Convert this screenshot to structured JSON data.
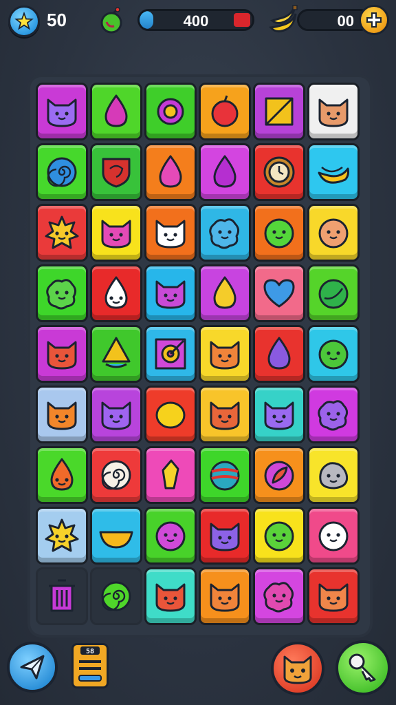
{
  "hud": {
    "stars": "50",
    "progress_value": "400",
    "progress_level": 0.12,
    "coins": "00",
    "icons": {
      "star": "star-icon",
      "apple": "apple-icon",
      "banana": "banana-icon",
      "plus": "plus-icon"
    }
  },
  "board": {
    "rows": [
      [
        {
          "bg": "#c93ad6",
          "icon": "cat-face-icon",
          "fg": "#9b6cf2"
        },
        {
          "bg": "#4fd62a",
          "icon": "drop-icon",
          "fg": "#d63ab8"
        },
        {
          "bg": "#3fce2a",
          "icon": "ring-icon",
          "fg": "#c53ad6"
        },
        {
          "bg": "#f6a21c",
          "icon": "apple-fruit-icon",
          "fg": "#e8333a"
        },
        {
          "bg": "#b742d8",
          "icon": "square-icon",
          "fg": "#f2c21c"
        },
        {
          "bg": "#f0f0f0",
          "icon": "cat-face-icon",
          "fg": "#e79a6a"
        }
      ],
      [
        {
          "bg": "#46d82c",
          "icon": "spiral-icon",
          "fg": "#2f8fe0"
        },
        {
          "bg": "#38c23a",
          "icon": "shield-icon",
          "fg": "#d6322e"
        },
        {
          "bg": "#f47e1c",
          "icon": "drop-icon",
          "fg": "#e54ab8"
        },
        {
          "bg": "#d345e0",
          "icon": "drop-icon",
          "fg": "#b52fd0"
        },
        {
          "bg": "#e8332e",
          "icon": "clock-icon",
          "fg": "#f3e6c2"
        },
        {
          "bg": "#2ec7ef",
          "icon": "banana-fruit-icon",
          "fg": "#f6c21c"
        }
      ],
      [
        {
          "bg": "#ea3a3a",
          "icon": "sun-icon",
          "fg": "#f6c92a"
        },
        {
          "bg": "#f8e21c",
          "icon": "cat-face-icon",
          "fg": "#e44ab6"
        },
        {
          "bg": "#f2701c",
          "icon": "cat-face-icon",
          "fg": "#ffffff"
        },
        {
          "bg": "#2fb7e6",
          "icon": "blob-icon",
          "fg": "#4eb6e9"
        },
        {
          "bg": "#f2701c",
          "icon": "round-face-icon",
          "fg": "#54d63a"
        },
        {
          "bg": "#f8d82a",
          "icon": "round-face-icon",
          "fg": "#f0a070"
        }
      ],
      [
        {
          "bg": "#3ed62a",
          "icon": "blob-icon",
          "fg": "#5cd34a"
        },
        {
          "bg": "#e82a2a",
          "icon": "drop-face-icon",
          "fg": "#ffffff"
        },
        {
          "bg": "#27b6ea",
          "icon": "cat-face-icon",
          "fg": "#c84ad6"
        },
        {
          "bg": "#c844e0",
          "icon": "drop-icon",
          "fg": "#f4cc2a"
        },
        {
          "bg": "#f26a8a",
          "icon": "heart-icon",
          "fg": "#3e9ae6"
        },
        {
          "bg": "#55d42a",
          "icon": "leaf-ball-icon",
          "fg": "#2fb24a"
        }
      ],
      [
        {
          "bg": "#c93ad6",
          "icon": "cat-face-icon",
          "fg": "#e8553a"
        },
        {
          "bg": "#40c82c",
          "icon": "cone-icon",
          "fg": "#f2c21c"
        },
        {
          "bg": "#2fb8e8",
          "icon": "target-icon",
          "fg": "#d6428a"
        },
        {
          "bg": "#f8d82a",
          "icon": "cat-face-icon",
          "fg": "#f0843a"
        },
        {
          "bg": "#e8332e",
          "icon": "drop-icon",
          "fg": "#8a5ae0"
        },
        {
          "bg": "#2fc7e8",
          "icon": "round-face-icon",
          "fg": "#4cc73a"
        }
      ],
      [
        {
          "bg": "#a9c8ee",
          "icon": "cat-face-icon",
          "fg": "#f2862a"
        },
        {
          "bg": "#b844dc",
          "icon": "cat-face-icon",
          "fg": "#9f64f0"
        },
        {
          "bg": "#ee3c2a",
          "icon": "lemon-icon",
          "fg": "#f6d21c"
        },
        {
          "bg": "#f8c42a",
          "icon": "cat-face-icon",
          "fg": "#e8663a"
        },
        {
          "bg": "#36d2c8",
          "icon": "cat-face-icon",
          "fg": "#9a6af0"
        },
        {
          "bg": "#d03ae0",
          "icon": "blob-icon",
          "fg": "#9c62ea"
        }
      ],
      [
        {
          "bg": "#4ad82a",
          "icon": "drop-face-icon",
          "fg": "#f06a2a"
        },
        {
          "bg": "#ee3a3a",
          "icon": "spiral-icon",
          "fg": "#f6f0e6"
        },
        {
          "bg": "#ee4ab8",
          "icon": "crayon-icon",
          "fg": "#f6d22a"
        },
        {
          "bg": "#3ed62a",
          "icon": "striped-ball-icon",
          "fg": "#2aa8c0"
        },
        {
          "bg": "#f6901c",
          "icon": "leaf-badge-icon",
          "fg": "#d048d8"
        },
        {
          "bg": "#f8e42a",
          "icon": "rock-face-icon",
          "fg": "#b8b8c0"
        }
      ],
      [
        {
          "bg": "#a4cdef",
          "icon": "sun-icon",
          "fg": "#f6d22a"
        },
        {
          "bg": "#2fbce8",
          "icon": "bowl-icon",
          "fg": "#f6b81c"
        },
        {
          "bg": "#48d22a",
          "icon": "round-face-icon",
          "fg": "#d04ad8"
        },
        {
          "bg": "#e82a2a",
          "icon": "cat-face-icon",
          "fg": "#8c62e6"
        },
        {
          "bg": "#f8e21c",
          "icon": "round-face-icon",
          "fg": "#5ad23a"
        },
        {
          "bg": "#f04a8a",
          "icon": "round-face-icon",
          "fg": "#ffffff"
        }
      ],
      [
        {
          "bg": "empty",
          "icon": "trash-icon",
          "fg": "#c63ad6"
        },
        {
          "bg": "empty",
          "icon": "spiral-icon",
          "fg": "#4fd62a"
        },
        {
          "bg": "#3fdcc8",
          "icon": "cat-face-icon",
          "fg": "#e8553a"
        },
        {
          "bg": "#f6901c",
          "icon": "cat-face-icon",
          "fg": "#f0843a"
        },
        {
          "bg": "#d446e0",
          "icon": "blob-icon",
          "fg": "#e04ab0"
        },
        {
          "bg": "#e8332e",
          "icon": "cat-face-icon",
          "fg": "#f0864a"
        }
      ]
    ]
  },
  "bottom": {
    "note_label": "58",
    "icons": {
      "send": "paper-plane-icon",
      "note": "notepad-icon",
      "cat": "cat-button-icon",
      "key": "key-icon"
    }
  }
}
